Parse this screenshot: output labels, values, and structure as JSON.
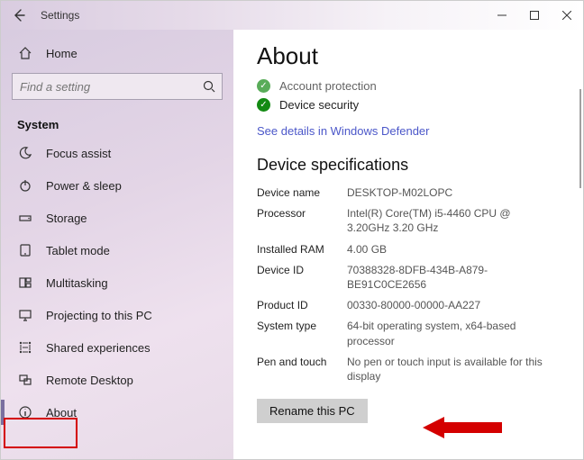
{
  "titlebar": {
    "title": "Settings"
  },
  "sidebar": {
    "home_label": "Home",
    "search_placeholder": "Find a setting",
    "section_header": "System",
    "items": [
      {
        "label": "Focus assist"
      },
      {
        "label": "Power & sleep"
      },
      {
        "label": "Storage"
      },
      {
        "label": "Tablet mode"
      },
      {
        "label": "Multitasking"
      },
      {
        "label": "Projecting to this PC"
      },
      {
        "label": "Shared experiences"
      },
      {
        "label": "Remote Desktop"
      },
      {
        "label": "About"
      }
    ]
  },
  "main": {
    "page_title": "About",
    "status": [
      {
        "label": "Account protection"
      },
      {
        "label": "Device security"
      }
    ],
    "defender_link": "See details in Windows Defender",
    "specs_title": "Device specifications",
    "specs": {
      "device_name_label": "Device name",
      "device_name_value": "DESKTOP-M02LOPC",
      "processor_label": "Processor",
      "processor_value": "Intel(R) Core(TM) i5-4460  CPU @ 3.20GHz 3.20 GHz",
      "ram_label": "Installed RAM",
      "ram_value": "4.00 GB",
      "device_id_label": "Device ID",
      "device_id_value": "70388328-8DFB-434B-A879-BE91C0CE2656",
      "product_id_label": "Product ID",
      "product_id_value": "00330-80000-00000-AA227",
      "system_type_label": "System type",
      "system_type_value": "64-bit operating system, x64-based processor",
      "pen_touch_label": "Pen and touch",
      "pen_touch_value": "No pen or touch input is available for this display"
    },
    "rename_button": "Rename this PC"
  }
}
